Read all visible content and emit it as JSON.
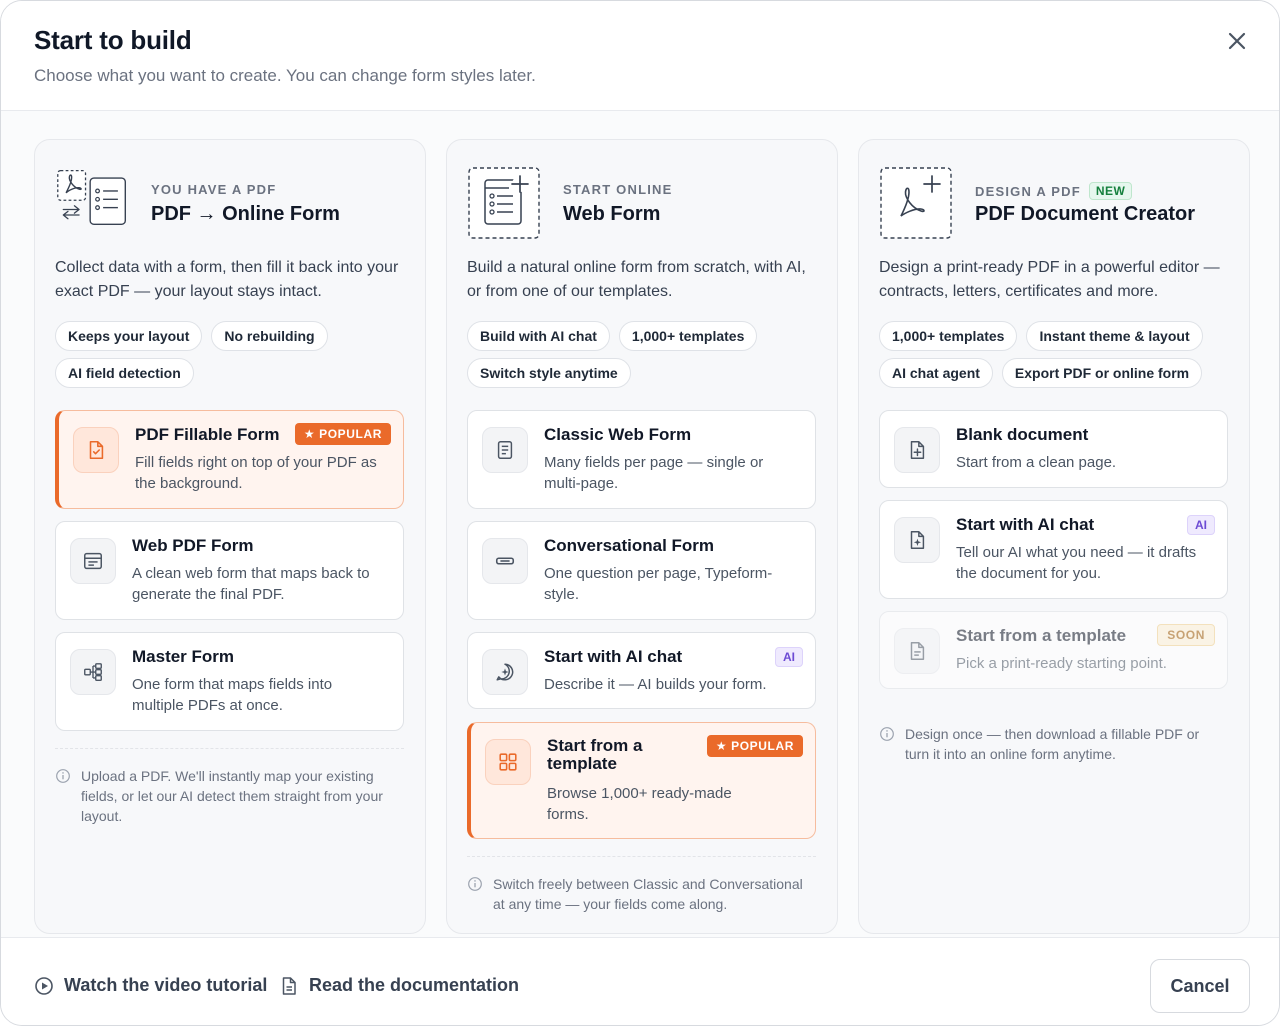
{
  "header": {
    "title": "Start to build",
    "subtitle": "Choose what you want to create. You can change form styles later."
  },
  "columns": [
    {
      "eyebrow": "YOU HAVE A PDF",
      "title": "PDF → Online Form",
      "description": "Collect data with a form, then fill it back into your exact PDF — your layout stays intact.",
      "chips": [
        "Keeps your layout",
        "No rebuilding",
        "AI field detection"
      ],
      "options": [
        {
          "title": "PDF Fillable Form",
          "description": "Fill fields right on top of your PDF as the background.",
          "badge": "★ POPULAR",
          "icon": "file-check-icon"
        },
        {
          "title": "Web PDF Form",
          "description": "A clean web form that maps back to generate the final PDF.",
          "icon": "web-form-icon"
        },
        {
          "title": "Master Form",
          "description": "One form that maps fields into multiple PDFs at once.",
          "icon": "hierarchy-icon"
        }
      ],
      "note": "Upload a PDF. We'll instantly map your existing fields, or let our AI detect them straight from your layout."
    },
    {
      "eyebrow": "START ONLINE",
      "title": "Web Form",
      "description": "Build a natural online form from scratch, with AI, or from one of our templates.",
      "chips": [
        "Build with AI chat",
        "1,000+ templates",
        "Switch style anytime"
      ],
      "options": [
        {
          "title": "Classic Web Form",
          "description": "Many fields per page — single or multi-page.",
          "icon": "document-lines-icon"
        },
        {
          "title": "Conversational Form",
          "description": "One question per page, Typeform-style.",
          "icon": "input-field-icon"
        },
        {
          "title": "Start with AI chat",
          "description": "Describe it — AI builds your form.",
          "badge": "AI",
          "icon": "chat-sparkle-icon"
        },
        {
          "title": "Start from a template",
          "description": "Browse 1,000+ ready-made forms.",
          "badge": "★ POPULAR",
          "icon": "grid-icon"
        }
      ],
      "note": "Switch freely between Classic and Conversational at any time — your fields come along."
    },
    {
      "eyebrow": "DESIGN A PDF",
      "eyebrow_badge": "NEW",
      "title": "PDF Document Creator",
      "description": "Design a print-ready PDF in a powerful editor — contracts, letters, certificates and more.",
      "chips": [
        "1,000+ templates",
        "Instant theme & layout",
        "AI chat agent",
        "Export PDF or online form"
      ],
      "options": [
        {
          "title": "Blank document",
          "description": "Start from a clean page.",
          "icon": "file-plus-icon"
        },
        {
          "title": "Start with AI chat",
          "description": "Tell our AI what you need — it drafts the document for you.",
          "badge": "AI",
          "icon": "file-sparkle-icon"
        },
        {
          "title": "Start from a template",
          "description": "Pick a print-ready starting point.",
          "badge": "SOON",
          "icon": "file-text-icon"
        }
      ],
      "note": "Design once — then download a fillable PDF or turn it into an online form anytime."
    }
  ],
  "footer": {
    "video_label": "Watch the video tutorial",
    "docs_label": "Read the documentation",
    "cancel_label": "Cancel"
  },
  "colors": {
    "accent": "#ea6a2a",
    "accent_light": "#fff4ef",
    "ai_badge": "#6d4bd4",
    "new_badge": "#15803d",
    "soon_badge": "#a15c07"
  }
}
